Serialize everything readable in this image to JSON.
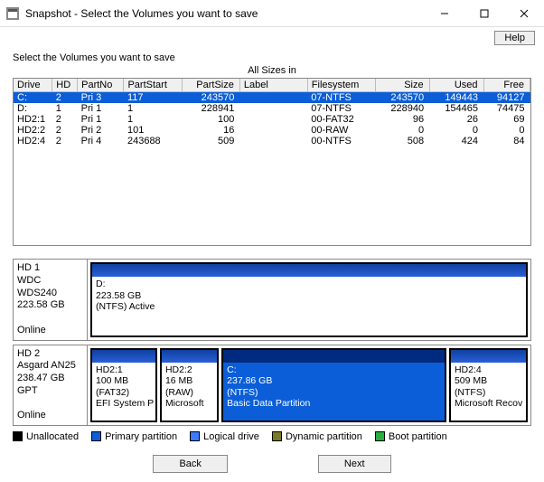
{
  "window": {
    "title": "Snapshot - Select the Volumes you want to save"
  },
  "help_label": "Help",
  "instruction": "Select the Volumes you want to save",
  "size_header": "All Sizes in",
  "table": {
    "headers": [
      "Drive",
      "HD",
      "PartNo",
      "PartStart",
      "PartSize",
      "Label",
      "Filesystem",
      "Size",
      "Used",
      "Free"
    ],
    "rows": [
      {
        "sel": true,
        "drive": "C:",
        "hd": "2",
        "partno": "Pri  3",
        "partstart": "117",
        "partsize": "243570",
        "label": "",
        "fs": "07-NTFS",
        "size": "243570",
        "used": "149443",
        "free": "94127"
      },
      {
        "sel": false,
        "drive": "D:",
        "hd": "1",
        "partno": "Pri  1",
        "partstart": "1",
        "partsize": "228941",
        "label": "",
        "fs": "07-NTFS",
        "size": "228940",
        "used": "154465",
        "free": "74475"
      },
      {
        "sel": false,
        "drive": "HD2:1",
        "hd": "2",
        "partno": "Pri  1",
        "partstart": "1",
        "partsize": "100",
        "label": "",
        "fs": "00-FAT32",
        "size": "96",
        "used": "26",
        "free": "69"
      },
      {
        "sel": false,
        "drive": "HD2:2",
        "hd": "2",
        "partno": "Pri  2",
        "partstart": "101",
        "partsize": "16",
        "label": "",
        "fs": "00-RAW",
        "size": "0",
        "used": "0",
        "free": "0"
      },
      {
        "sel": false,
        "drive": "HD2:4",
        "hd": "2",
        "partno": "Pri  4",
        "partstart": "243688",
        "partsize": "509",
        "label": "",
        "fs": "00-NTFS",
        "size": "508",
        "used": "424",
        "free": "84"
      }
    ]
  },
  "disks": [
    {
      "name": "HD 1",
      "model": "WDC WDS240",
      "size": "223.58 GB",
      "scheme": "",
      "status": "Online",
      "parts": [
        {
          "sel": false,
          "flex": 1,
          "line1": "D:",
          "line2": "223.58 GB",
          "line3": "(NTFS) Active",
          "line4": ""
        }
      ]
    },
    {
      "name": "HD 2",
      "model": "Asgard AN25",
      "size": "238.47 GB",
      "scheme": "GPT",
      "status": "Online",
      "parts": [
        {
          "sel": false,
          "flex": 0.16,
          "line1": "HD2:1",
          "line2": "100 MB",
          "line3": "(FAT32)",
          "line4": "EFI System P"
        },
        {
          "sel": false,
          "flex": 0.14,
          "line1": "HD2:2",
          "line2": "16 MB",
          "line3": "(RAW)",
          "line4": "Microsoft"
        },
        {
          "sel": true,
          "flex": 0.56,
          "line1": "C:",
          "line2": "237.86 GB",
          "line3": "(NTFS)",
          "line4": "Basic Data Partition"
        },
        {
          "sel": false,
          "flex": 0.19,
          "line1": "HD2:4",
          "line2": "509 MB",
          "line3": "(NTFS)",
          "line4": "Microsoft Recov"
        }
      ]
    }
  ],
  "legend": {
    "unalloc": "Unallocated",
    "primary": "Primary partition",
    "logical": "Logical drive",
    "dynamic": "Dynamic partition",
    "boot": "Boot partition"
  },
  "buttons": {
    "back": "Back",
    "next": "Next"
  }
}
